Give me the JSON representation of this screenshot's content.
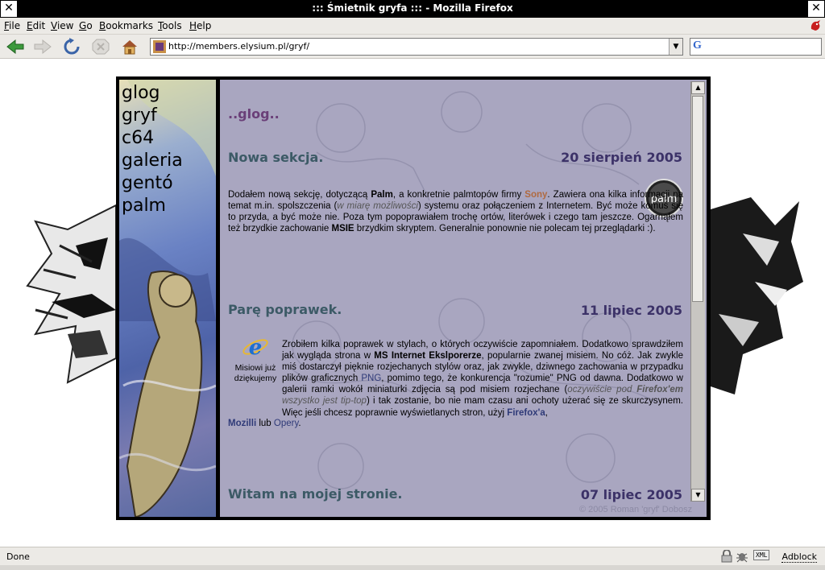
{
  "window": {
    "title": "::: Śmietnik gryfa ::: - Mozilla Firefox"
  },
  "menu": [
    "File",
    "Edit",
    "View",
    "Go",
    "Bookmarks",
    "Tools",
    "Help"
  ],
  "navbar": {
    "url": "http://members.elysium.pl/gryf/",
    "search_placeholder": ""
  },
  "status": {
    "text": "Done",
    "adblock": "Adblock",
    "xml_badge": "XML"
  },
  "site": {
    "nav_links": [
      "glog",
      "gryf",
      "c64",
      "galeria",
      "gentó",
      "palm"
    ],
    "section_heading": "..glog..",
    "posts": [
      {
        "title": "Nowa sekcja.",
        "date": "20 sierpień 2005",
        "badge": "palm"
      },
      {
        "title": "Parę poprawek.",
        "date": "11 lipiec 2005",
        "caption": "Misiowi już dziękujemy"
      },
      {
        "title": "Witam na mojej stronie.",
        "date": "07 lipiec 2005"
      }
    ],
    "post1_text": {
      "t1": "Dodałem nową sekcję, dotyczącą ",
      "palm": "Palm",
      "t2": ", a konkretnie palmtopów firmy ",
      "sony": "Sony",
      "t3": ". Zawiera ona kilka informacji na temat m.in. spolszczenia (",
      "ital": "w miarę możliwości",
      "t4": ") systemu oraz połączeniem z Internetem. Być może komuś się to przyda, a być może nie. Poza tym popoprawiałem trochę ortów, literówek i czego tam jeszcze. Ogarnąłem też brzydkie zachowanie ",
      "msie": "MSIE",
      "t5": " brzydkim skryptem. Generalnie ponownie nie polecam tej przeglądarki :)."
    },
    "post2_text": {
      "t1": "Zrobiłem kilka poprawek w stylach, o których oczywiście zapomniałem. Dodatkowo sprawdziłem jak wygląda strona w ",
      "msie": "MS Internet Ekslporerze",
      "t2": ", popularnie zwanej misiem. No cóż. Jak zwykle miś dostarczył pięknie rozjechanych stylów oraz, jak zwykle, dziwnego zachowania w przypadku plików graficznych ",
      "png": "PNG",
      "t3": ", pomimo tego, że konkurencja \"rozumie\" PNG od dawna. Dodatkowo w galerii ramki wokół miniaturki zdjęcia są pod misiem rozjechane (",
      "ital1": "oczywiście pod ",
      "ff": "Firefox'em",
      "ital2": " wszystko jest tip-top",
      "t4": ") i tak zostanie, bo nie mam czasu ani ochoty użerać się ze skurczysynem. Więc jeśli chcesz poprawnie wyświetlanych stron, użyj ",
      "ffa": "Firefox'a",
      "t5": ", ",
      "mozilla": "Mozilli",
      "t6": " lub ",
      "opera": "Opery",
      "t7": "."
    },
    "copyright": "© 2005 Roman 'gryf' Dobosz"
  },
  "icons": [
    "back-arrow-icon",
    "forward-arrow-icon",
    "reload-icon",
    "stop-icon",
    "home-icon",
    "site-favicon-icon",
    "google-search-icon",
    "lock-icon",
    "bug-icon",
    "throbber-icon",
    "ie-logo-icon",
    "palm-logo-icon"
  ]
}
